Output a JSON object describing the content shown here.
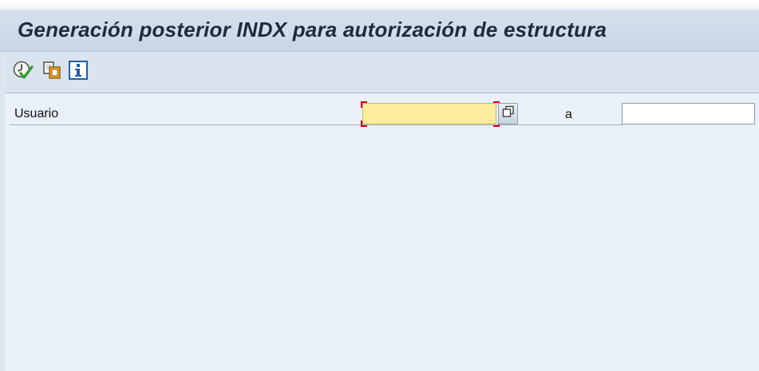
{
  "window": {
    "title": "Generación posterior INDX para autorización de estructura"
  },
  "toolbar": {
    "buttons": [
      {
        "icon": "execute-clock-check-icon"
      },
      {
        "icon": "copy-variant-icon"
      },
      {
        "icon": "info-icon"
      }
    ]
  },
  "form": {
    "user_label": "Usuario",
    "user_from_value": "",
    "to_label": "a",
    "user_to_value": ""
  },
  "colors": {
    "required_field": "#fcec9e",
    "required_marker": "#d0021b",
    "background": "#e9f0f7",
    "toolbar": "#d9e4ee"
  }
}
